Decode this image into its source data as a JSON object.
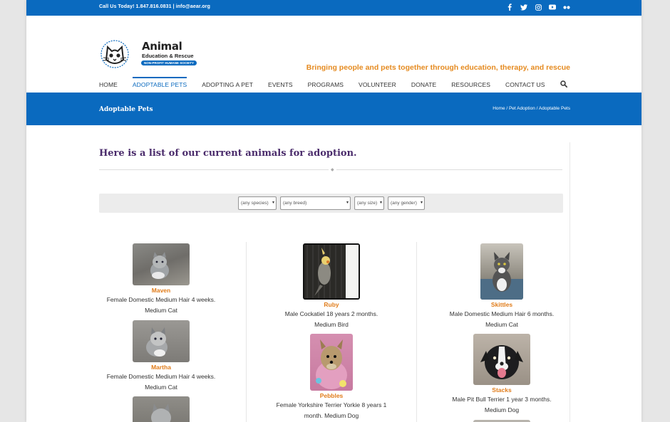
{
  "topbar": {
    "contact": "Call Us Today! 1.847.816.0831  |  info@aear.org",
    "social_icons": [
      "facebook-icon",
      "twitter-icon",
      "instagram-icon",
      "youtube-icon",
      "flickr-icon"
    ]
  },
  "logo": {
    "name": "Animal",
    "subtitle": "Education & Rescue",
    "badge": "NON-PROFIT HUMANE SOCIETY"
  },
  "tagline": "Bringing people and pets together through education, therapy, and rescue",
  "nav": {
    "items": [
      "HOME",
      "ADOPTABLE PETS",
      "ADOPTING A PET",
      "EVENTS",
      "PROGRAMS",
      "VOLUNTEER",
      "DONATE",
      "RESOURCES",
      "CONTACT US"
    ],
    "active": "ADOPTABLE PETS"
  },
  "titlebar": {
    "title": "Adoptable Pets",
    "breadcrumb": "Home  /  Pet Adoption  /  Adoptable Pets"
  },
  "main": {
    "heading": "Here is a list of our current animals for adoption."
  },
  "filters": {
    "species": "(any species)",
    "breed": "(any breed)",
    "size": "(any size)",
    "gender": "(any gender)"
  },
  "pets": [
    {
      "name": "Maven",
      "desc": "Female Domestic Medium Hair 4 weeks.",
      "size": "Medium Cat"
    },
    {
      "name": "Martha",
      "desc": "Female Domestic Medium Hair 4 weeks.",
      "size": "Medium Cat"
    },
    {
      "name": "Ruby",
      "desc": "Male Cockatiel 18 years 2 months.",
      "size": "Medium Bird"
    },
    {
      "name": "Pebbles",
      "desc": "Female Yorkshire Terrier Yorkie 8 years 1",
      "desc2": "month. Medium Dog"
    },
    {
      "name": "Skittles",
      "desc": "Male Domestic Medium Hair 6 months.",
      "size": "Medium Cat"
    },
    {
      "name": "Stacks",
      "desc": "Male Pit Bull Terrier 1 year 3 months.",
      "size": "Medium Dog"
    }
  ],
  "colors": {
    "brand_blue": "#0a6abf",
    "tagline_orange": "#e58a1f",
    "pet_name_orange": "#e07c1a",
    "heading_purple": "#4a2b6b"
  }
}
